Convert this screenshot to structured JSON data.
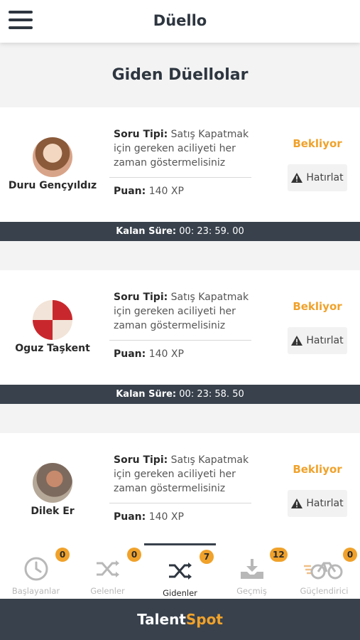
{
  "header": {
    "title": "Düello"
  },
  "section_title": "Giden Düellolar",
  "labels": {
    "question_type": "Soru Tipi:",
    "points": "Puan:",
    "remaining": "Kalan Süre:",
    "remind": "Hatırlat"
  },
  "duels": [
    {
      "user": "Duru Gençyıldız",
      "question": "Satış Kapatmak için gereken aciliyeti her zaman göstermelisiniz",
      "points": "140 XP",
      "status": "Bekliyor",
      "remaining": "00: 23: 59. 00"
    },
    {
      "user": "Oguz Taşkent",
      "question": "Satış Kapatmak için gereken aciliyeti her zaman göstermelisiniz",
      "points": "140 XP",
      "status": "Bekliyor",
      "remaining": "00: 23: 58. 50"
    },
    {
      "user": "Dilek Er",
      "question": "Satış Kapatmak için gereken aciliyeti her zaman göstermelisiniz",
      "points": "140 XP",
      "status": "Bekliyor"
    }
  ],
  "tabs": [
    {
      "label": "Başlayanlar",
      "badge": "0",
      "icon": "clock-icon"
    },
    {
      "label": "Gelenler",
      "badge": "0",
      "icon": "shuffle-icon"
    },
    {
      "label": "Gidenler",
      "badge": "7",
      "icon": "shuffle-icon"
    },
    {
      "label": "Geçmiş",
      "badge": "12",
      "icon": "download-icon"
    },
    {
      "label": "Güçlendirici",
      "badge": "0",
      "icon": "bicycle-icon"
    }
  ],
  "brand": {
    "part1": "Talent",
    "part2": "Spot"
  },
  "colors": {
    "accent": "#f0a22b",
    "dark": "#38414c",
    "inactive": "#b8b8b8"
  }
}
